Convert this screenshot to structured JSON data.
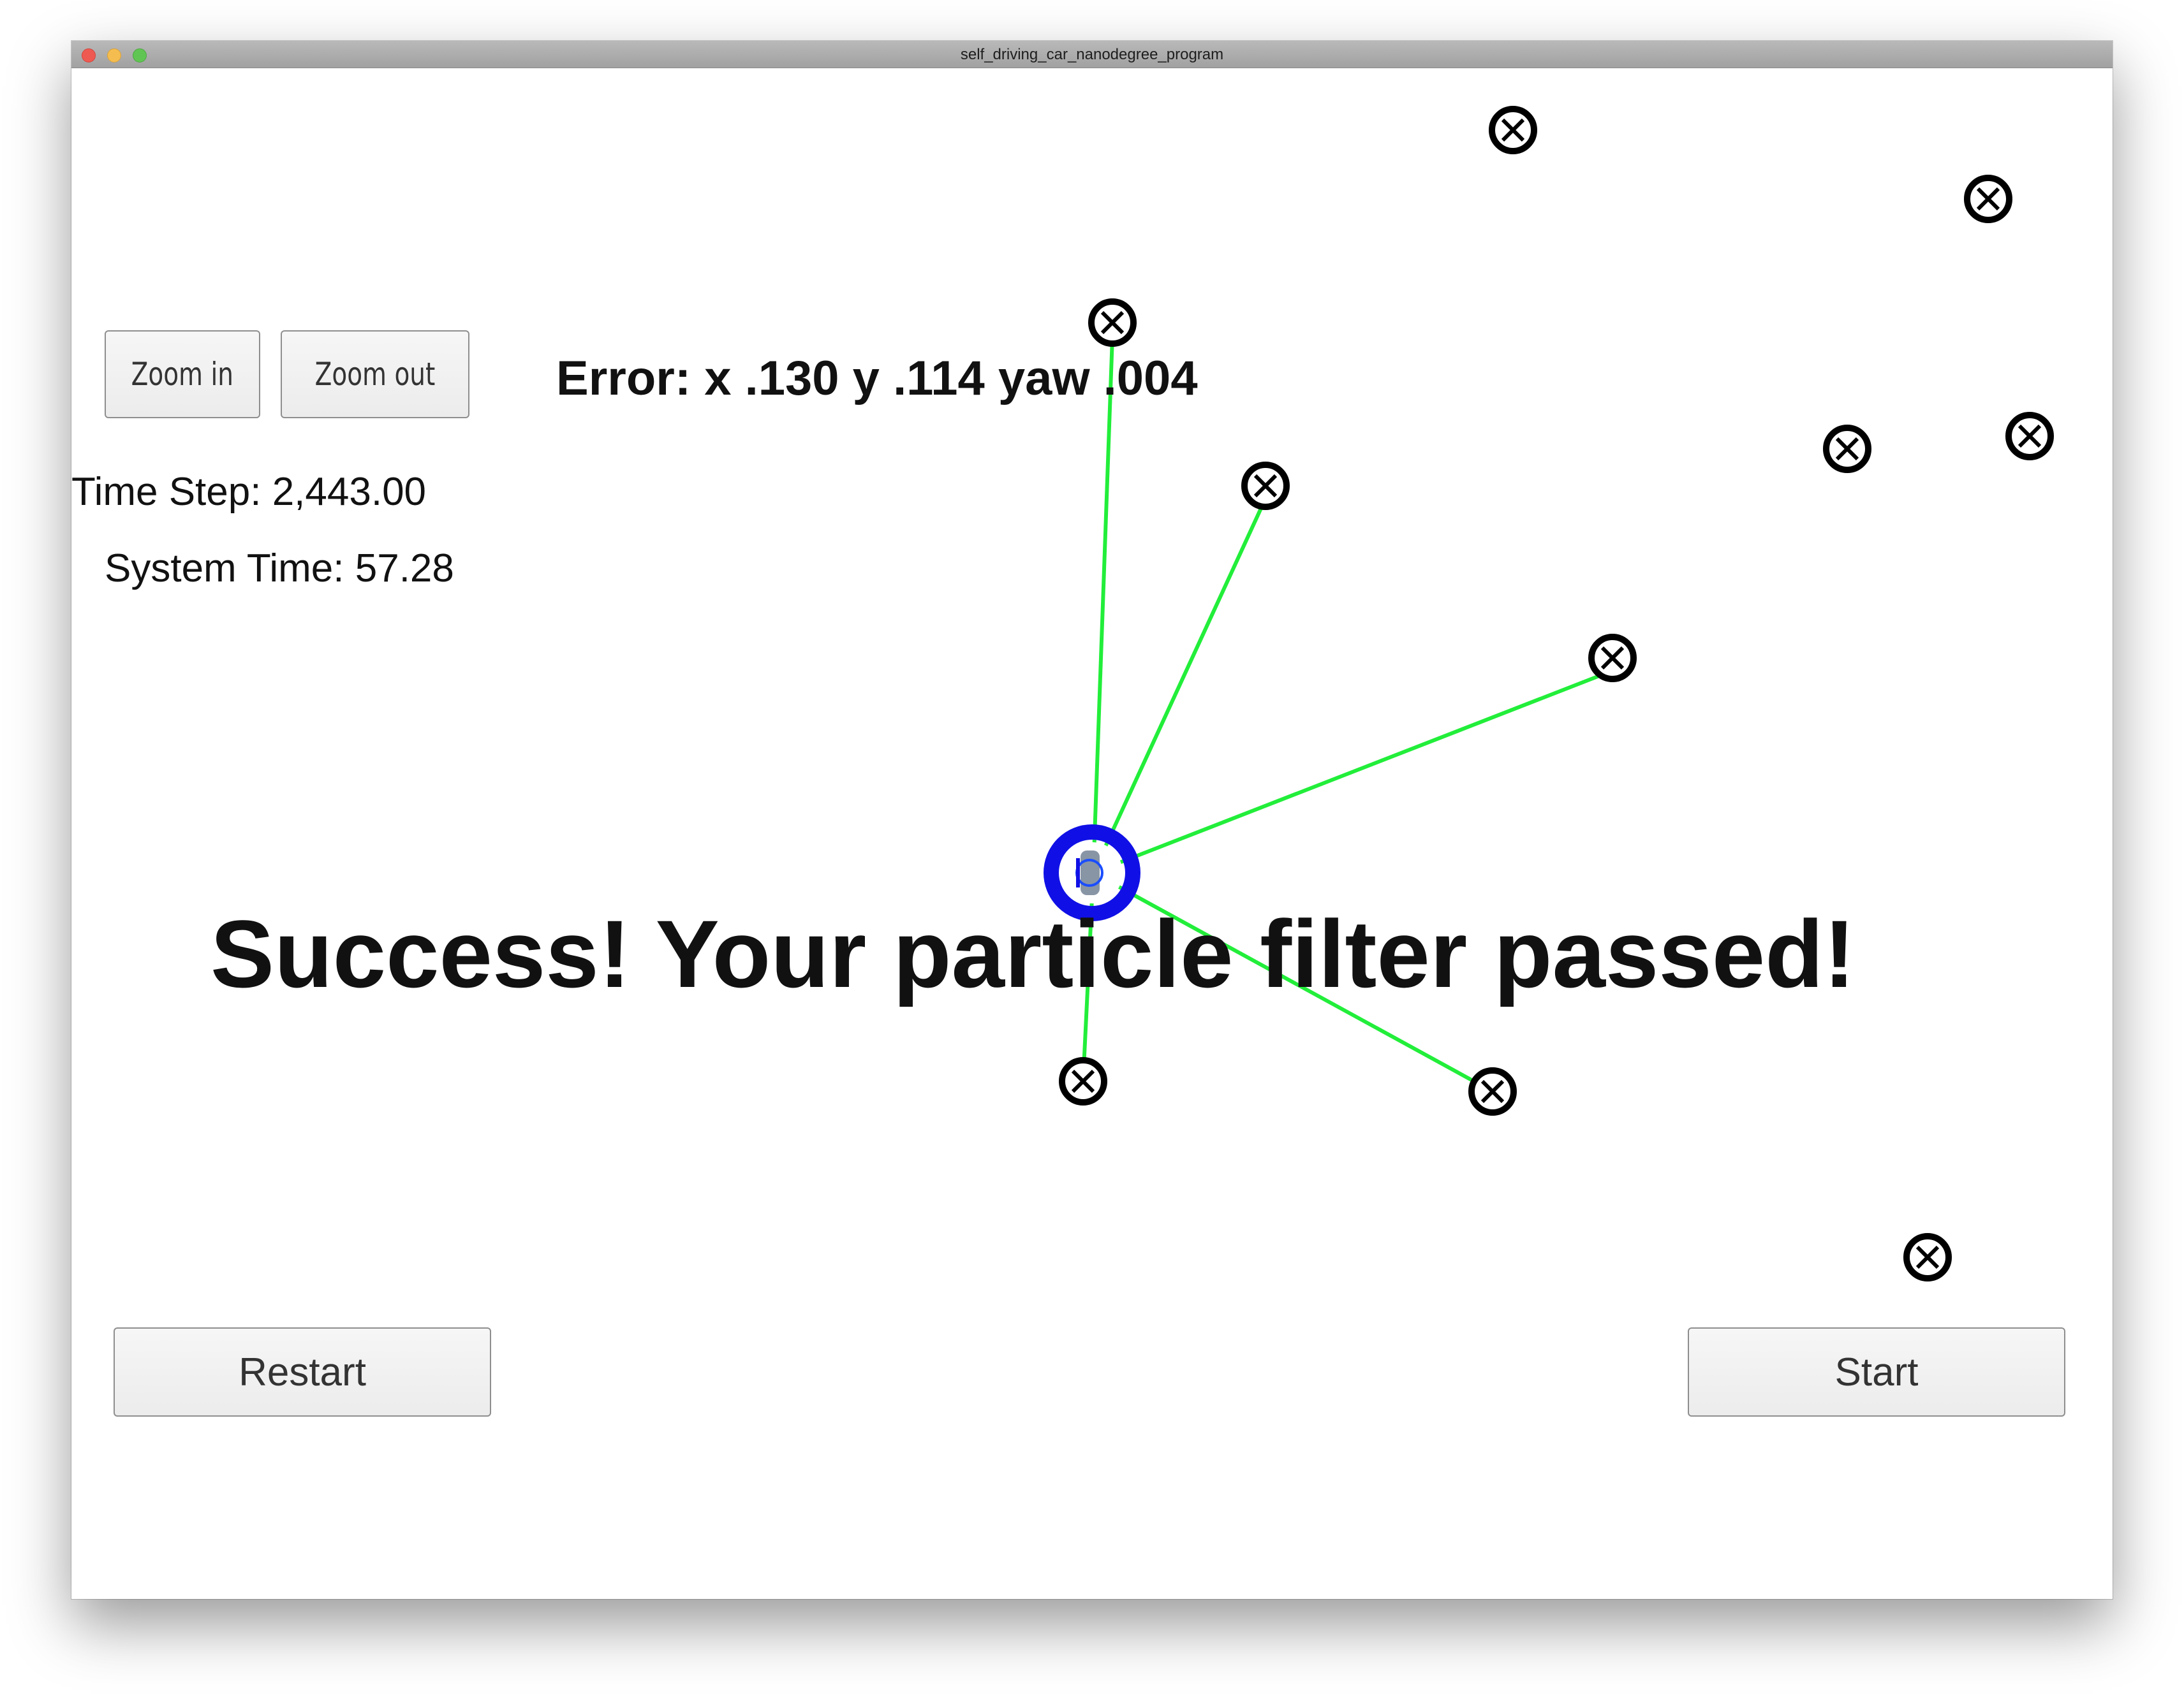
{
  "window": {
    "title": "self_driving_car_nanodegree_program",
    "traffic_lights": [
      {
        "name": "close",
        "color": "#ee5a52"
      },
      {
        "name": "minimize",
        "color": "#f5bd4f"
      },
      {
        "name": "zoom",
        "color": "#61c554"
      }
    ]
  },
  "controls": {
    "zoom_in_label": "Zoom in",
    "zoom_out_label": "Zoom out",
    "restart_label": "Restart",
    "start_label": "Start"
  },
  "status": {
    "error_text": "Error: x .130 y .114 yaw .004",
    "time_step_text": "Time Step: 2,443.00",
    "system_time_text": "System Time: 57.28",
    "success_text": "Success! Your particle filter passed!"
  },
  "simulation": {
    "landmark_icon": "circle-x-icon",
    "vehicle_icon": "car-icon",
    "colors": {
      "observation_line": "#22ee3a",
      "vehicle_ring": "#1010e6",
      "landmark": "#000000",
      "success_text": "#000000",
      "error_text": "#000000"
    }
  }
}
